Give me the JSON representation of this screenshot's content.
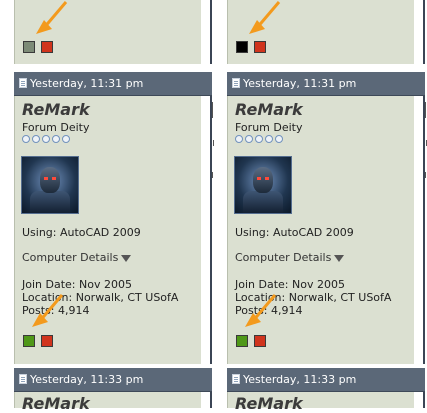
{
  "posts": [
    {
      "timestamp": "Yesterday, 11:31 pm",
      "username": "ReMark",
      "title": "Forum Deity",
      "using": "Using: AutoCAD 2009",
      "details": "Computer Details",
      "join": "Join Date: Nov 2005",
      "location": "Location: Norwalk, CT USofA",
      "posts": "Posts: 4,914"
    },
    {
      "timestamp": "Yesterday, 11:33 pm",
      "username": "ReMark"
    }
  ],
  "status_colors": {
    "left_top_online": "#7d8b77",
    "right_top_online": "#000000",
    "online_green": "#4f9818",
    "offline_red": "#d0341d",
    "arrow": "#f39a1d"
  },
  "icons": [
    "document-icon",
    "arrow-icon",
    "reputation-icon",
    "chevron-down-icon"
  ]
}
